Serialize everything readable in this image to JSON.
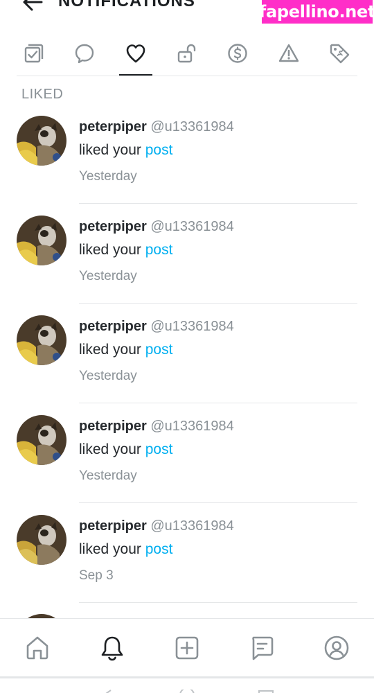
{
  "header": {
    "title": "NOTIFICATIONS",
    "back_icon": "arrow-left-icon"
  },
  "watermark": "fapellino.net",
  "colors": {
    "link": "#00aff0",
    "muted": "#8a9196",
    "text": "#262a2e",
    "watermark_bg": "#ff2ec8"
  },
  "tabs": [
    {
      "icon": "checkbox-stack-icon",
      "active": false
    },
    {
      "icon": "comment-icon",
      "active": false
    },
    {
      "icon": "heart-icon",
      "active": true
    },
    {
      "icon": "unlock-icon",
      "active": false
    },
    {
      "icon": "dollar-circle-icon",
      "active": false
    },
    {
      "icon": "warning-icon",
      "active": false
    },
    {
      "icon": "tag-icon",
      "active": false
    }
  ],
  "section_label": "LIKED",
  "notifications": [
    {
      "username": "peterpiper",
      "handle": "@u13361984",
      "action": "liked your",
      "link": "post",
      "time": "Yesterday"
    },
    {
      "username": "peterpiper",
      "handle": "@u13361984",
      "action": "liked your",
      "link": "post",
      "time": "Yesterday"
    },
    {
      "username": "peterpiper",
      "handle": "@u13361984",
      "action": "liked your",
      "link": "post",
      "time": "Yesterday"
    },
    {
      "username": "peterpiper",
      "handle": "@u13361984",
      "action": "liked your",
      "link": "post",
      "time": "Yesterday"
    },
    {
      "username": "peterpiper",
      "handle": "@u13361984",
      "action": "liked your",
      "link": "post",
      "time": "Sep 3"
    }
  ],
  "bottom_nav": [
    {
      "icon": "home-icon",
      "active": false
    },
    {
      "icon": "bell-icon",
      "active": true
    },
    {
      "icon": "plus-square-icon",
      "active": false
    },
    {
      "icon": "messages-icon",
      "active": false
    },
    {
      "icon": "profile-icon",
      "active": false
    }
  ]
}
